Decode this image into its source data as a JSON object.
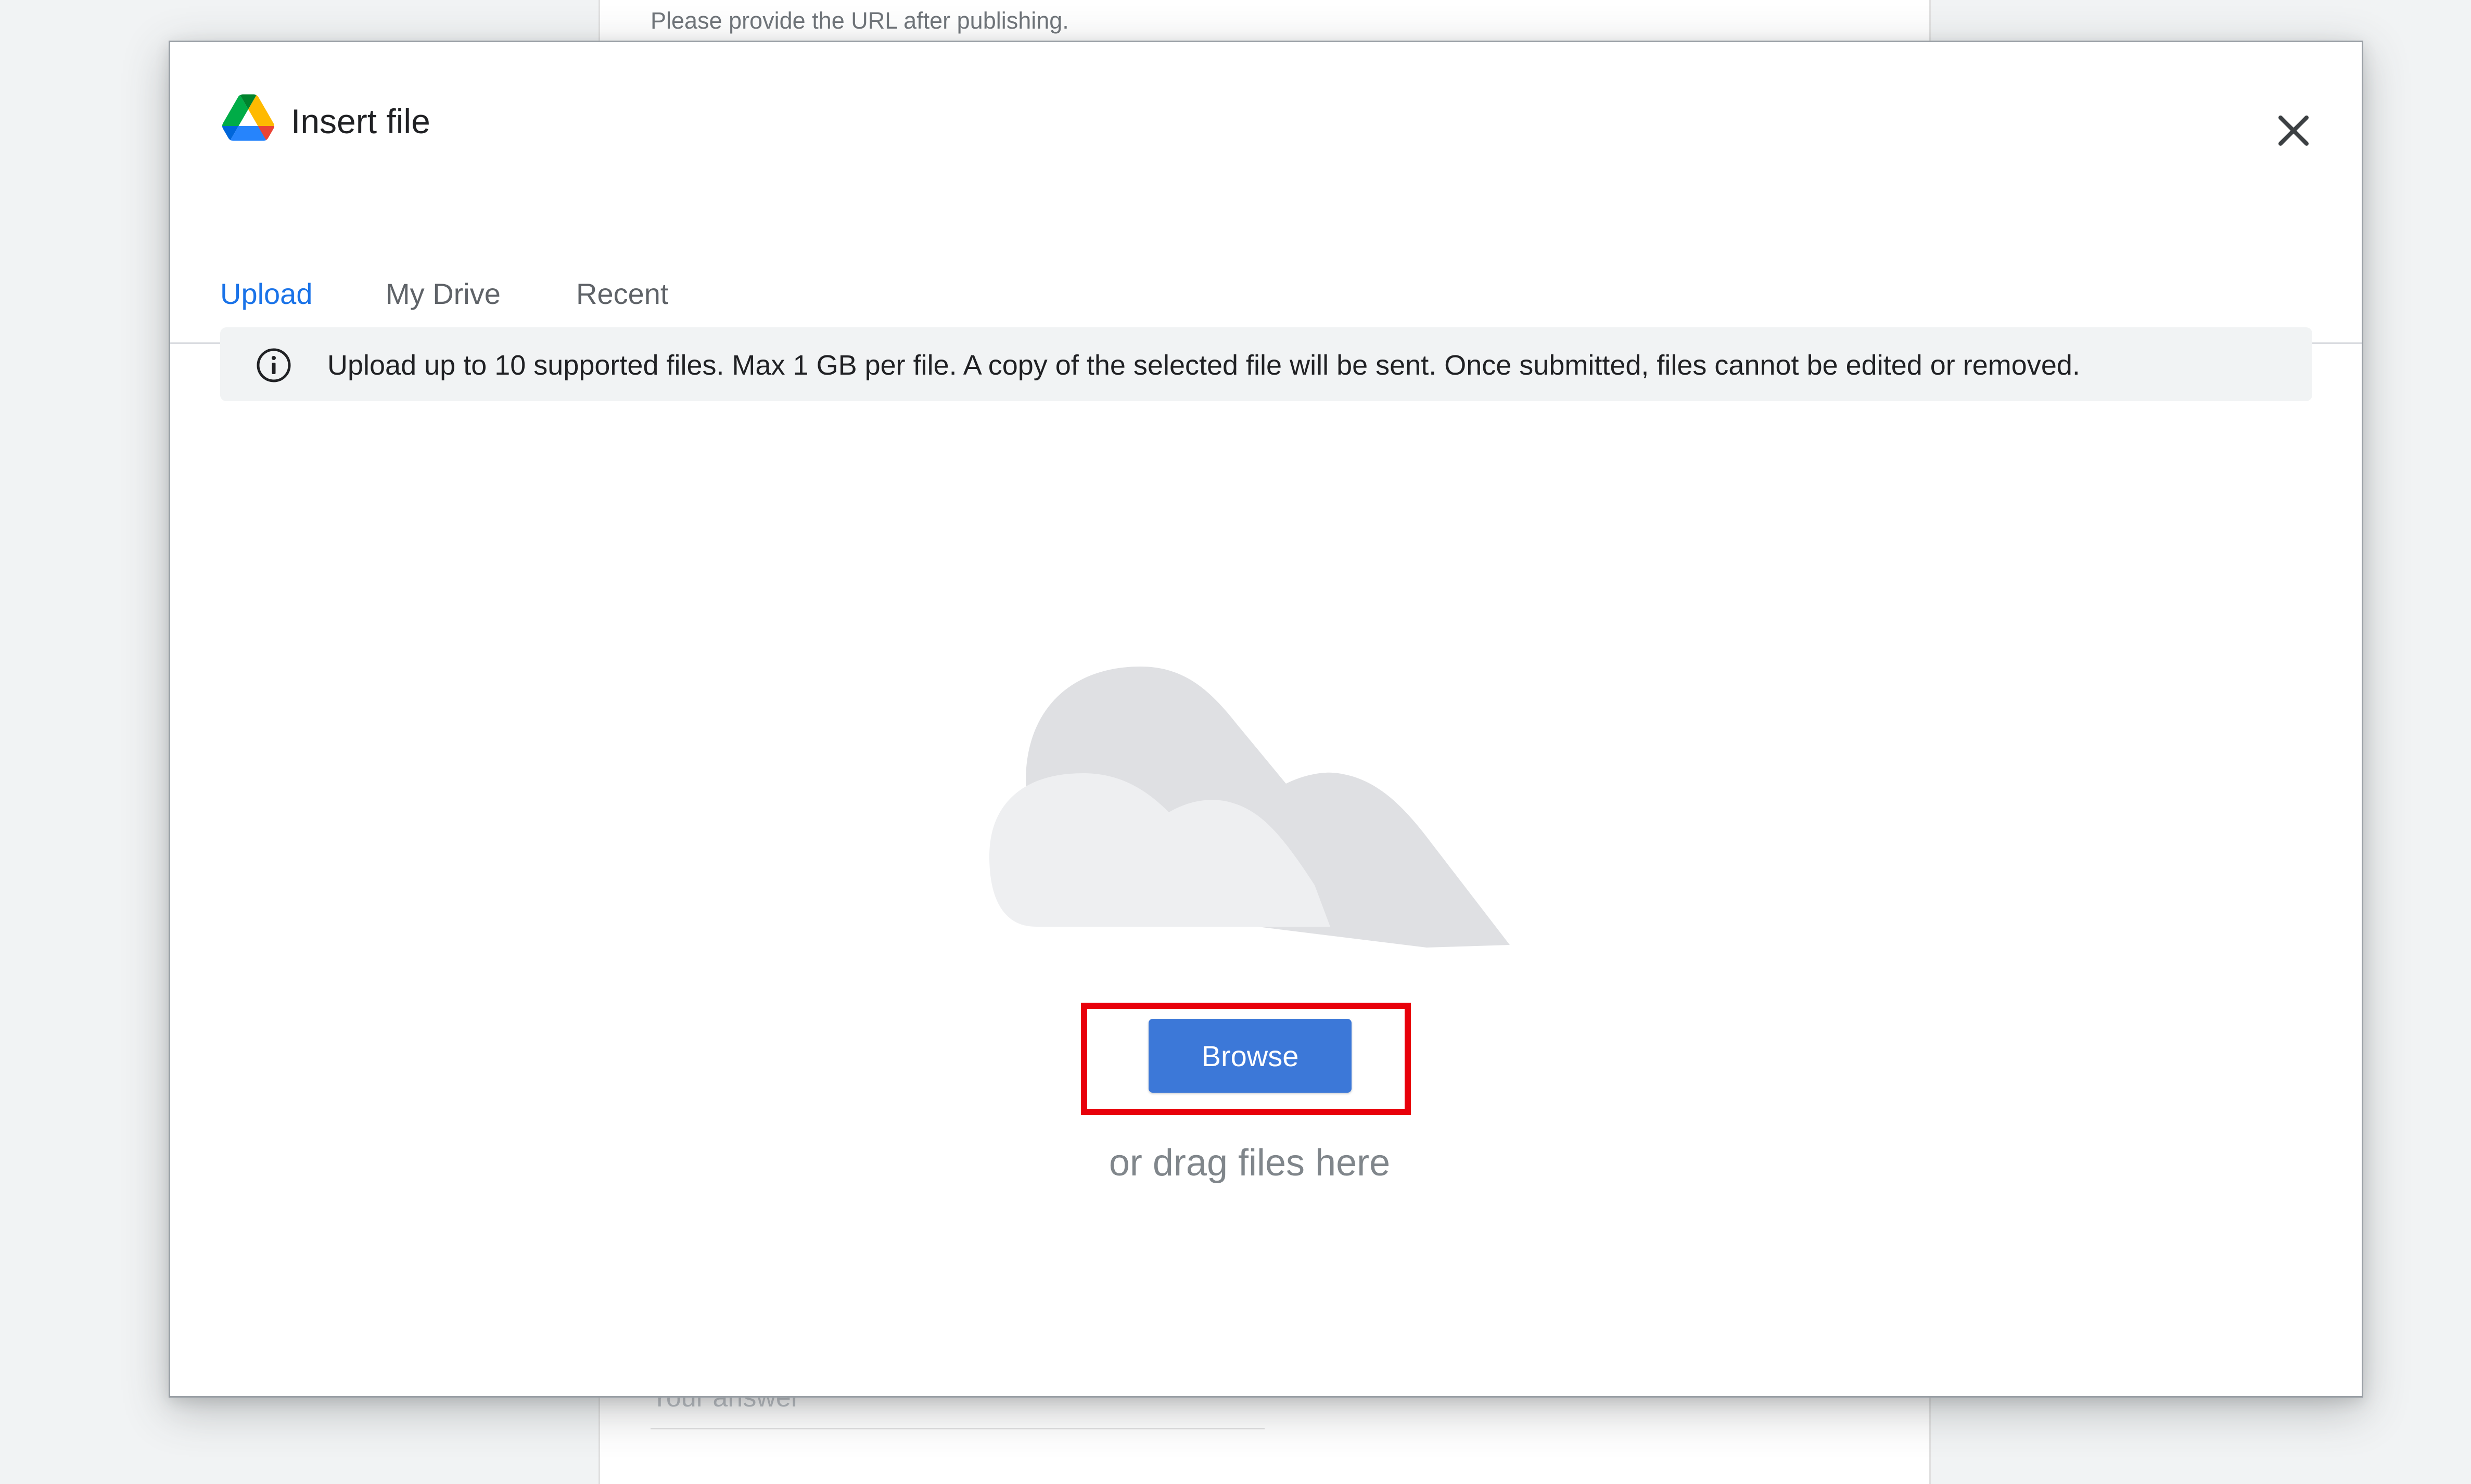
{
  "background": {
    "hint_text": "Please provide the URL after publishing.",
    "answer_placeholder": "Your answer"
  },
  "dialog": {
    "title": "Insert file",
    "logo_icon": "google-drive-icon",
    "close_icon": "close-icon",
    "tabs": [
      {
        "label": "Upload",
        "active": true
      },
      {
        "label": "My Drive",
        "active": false
      },
      {
        "label": "Recent",
        "active": false
      }
    ],
    "info": {
      "icon": "info-icon",
      "text": "Upload up to 10 supported files. Max 1 GB per file. A copy of the selected file will be sent. Once submitted, files cannot be edited or removed."
    },
    "upload": {
      "illustration": "cloud-illustration",
      "browse_label": "Browse",
      "drag_text": "or drag files here"
    }
  },
  "colors": {
    "accent": "#1a73e8",
    "browse_button": "#3c78d8",
    "highlight_box": "#e8000b"
  }
}
